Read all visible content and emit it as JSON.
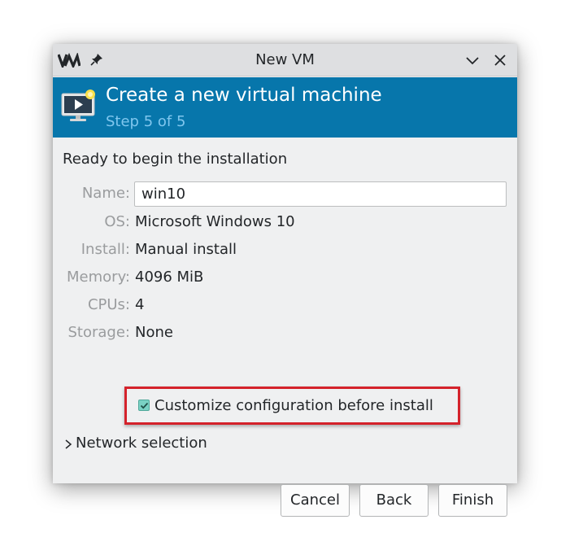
{
  "window": {
    "title": "New VM",
    "app_icon": "vm-icon",
    "pin_icon": "pin-icon",
    "minimize_icon": "chevron-down-icon",
    "close_icon": "close-icon"
  },
  "header": {
    "title": "Create a new virtual machine",
    "step": "Step 5 of 5",
    "icon": "monitor-play-icon",
    "background": "#0776ab"
  },
  "summary": {
    "heading": "Ready to begin the installation",
    "name_label": "Name:",
    "name_value": "win10",
    "os_label": "OS:",
    "os_value": "Microsoft Windows 10",
    "install_label": "Install:",
    "install_value": "Manual install",
    "memory_label": "Memory:",
    "memory_value": "4096 MiB",
    "cpus_label": "CPUs:",
    "cpus_value": "4",
    "storage_label": "Storage:",
    "storage_value": "None"
  },
  "customize": {
    "label": "Customize configuration before install",
    "checked": true,
    "highlight_color": "#d4222b"
  },
  "network": {
    "label": "Network selection",
    "icon": "chevron-right-icon"
  },
  "buttons": {
    "cancel": "Cancel",
    "back": "Back",
    "finish": "Finish"
  }
}
